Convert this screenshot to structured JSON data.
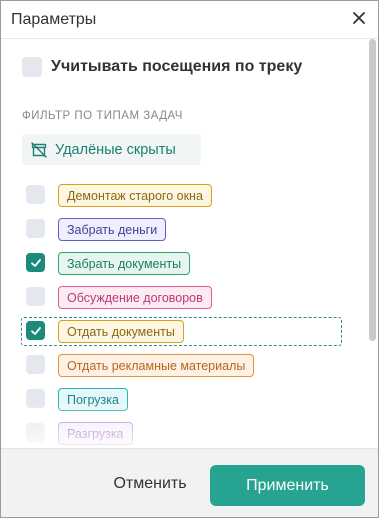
{
  "dialog": {
    "title": "Параметры",
    "close_icon": "close-icon"
  },
  "track_visits": {
    "label": "Учитывать посещения по треку",
    "checked": false
  },
  "filter": {
    "section_label": "ФИЛЬТР ПО ТИПАМ ЗАДАЧ",
    "hidden_button_label": "Удалёные скрыты",
    "hidden_button_icon": "archive-crossed-icon",
    "items": [
      {
        "label": "Демонтаж старого окна",
        "checked": false,
        "color": "#d9a21a",
        "bg": "#fdf6e3",
        "text": "#8a6a10"
      },
      {
        "label": "Забрать деньги",
        "checked": false,
        "color": "#5b5fc7",
        "bg": "#eeeefc",
        "text": "#3f4399"
      },
      {
        "label": "Забрать документы",
        "checked": true,
        "color": "#2aa37c",
        "bg": "#e6f6ef",
        "text": "#1b7f5d"
      },
      {
        "label": "Обсуждение договоров",
        "checked": false,
        "color": "#e25a9e",
        "bg": "#fdebf4",
        "text": "#b93a7b"
      },
      {
        "label": "Отдать документы",
        "checked": true,
        "color": "#d9a21a",
        "bg": "#fdf6e3",
        "text": "#8a6a10"
      },
      {
        "label": "Отдать рекламные материалы",
        "checked": false,
        "color": "#e8923c",
        "bg": "#fdf1e6",
        "text": "#b8661a"
      },
      {
        "label": "Погрузка",
        "checked": false,
        "color": "#27b3bd",
        "bg": "#e5f7f8",
        "text": "#19838b"
      },
      {
        "label": "Разгрузка",
        "checked": false,
        "color": "#b97fd6",
        "bg": "#f5ecfa",
        "text": "#8b52a8"
      }
    ]
  },
  "footer": {
    "cancel_label": "Отменить",
    "apply_label": "Применить"
  },
  "colors": {
    "accent": "#27a491",
    "checkbox_checked": "#1b8a7a",
    "checkbox_unchecked": "#e4e7ee"
  }
}
